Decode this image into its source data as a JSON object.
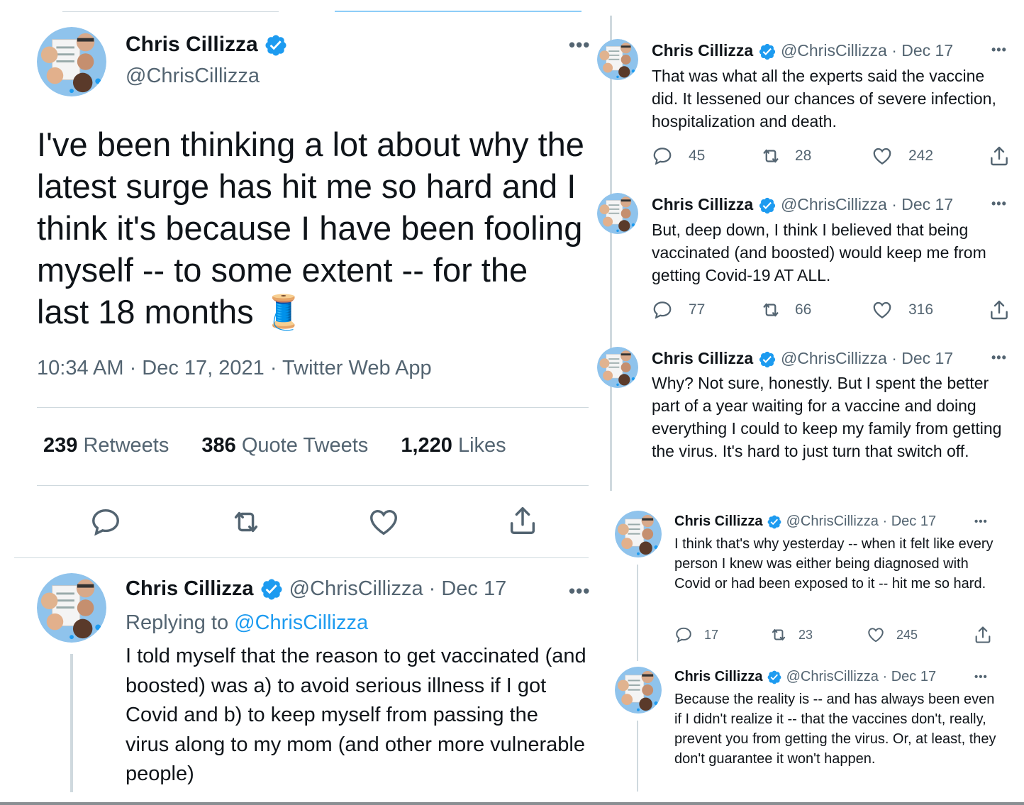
{
  "author": {
    "name": "Chris Cillizza",
    "handle": "@ChrisCillizza"
  },
  "main_tweet": {
    "text": "I've been thinking a lot about why the latest surge has hit me so hard and I think it's because I have been fooling myself -- to some extent -- for the last 18 months",
    "emoji": "🧵",
    "timestamp": "10:34 AM · Dec 17, 2021 · Twitter Web App",
    "stats": {
      "retweets_count": "239",
      "retweets_label": "Retweets",
      "quotes_count": "386",
      "quotes_label": "Quote Tweets",
      "likes_count": "1,220",
      "likes_label": "Likes"
    }
  },
  "reply_tweet": {
    "date": "· Dec 17",
    "replying_prefix": "Replying to",
    "replying_handle": "@ChrisCillizza",
    "text": "I told myself that the reason to get vaccinated (and boosted) was a) to avoid serious illness if I got Covid and b) to keep myself from passing the virus along to my mom (and other more vulnerable people)"
  },
  "thread": [
    {
      "date": "· Dec 17",
      "text": "That was what all the experts said the vaccine did. It lessened our chances of severe infection, hospitalization and death.",
      "replies": "45",
      "retweets": "28",
      "likes": "242"
    },
    {
      "date": "· Dec 17",
      "text": "But, deep down, I think I believed that being vaccinated (and boosted) would keep me from getting Covid-19 AT ALL.",
      "replies": "77",
      "retweets": "66",
      "likes": "316"
    },
    {
      "date": "· Dec 17",
      "text": "Why? Not sure, honestly. But I spent the better part of a year waiting for a vaccine and doing everything I could to keep my family from getting the virus.  It's hard to just turn that switch off."
    },
    {
      "date": "· Dec 17",
      "text": "I think that's why yesterday -- when it felt like every person I knew was either being diagnosed with Covid or had been exposed to it -- hit me so hard.",
      "replies": "17",
      "retweets": "23",
      "likes": "245"
    },
    {
      "date": "· Dec 17",
      "text": "Because the reality is -- and has always been even if I didn't realize it -- that the vaccines don't, really, prevent you from getting the virus. Or, at least, they don't guarantee it won't happen."
    }
  ],
  "colors": {
    "text": "#0f1419",
    "secondary": "#536471",
    "accent": "#1d9bf0",
    "divider": "#cfd9de"
  },
  "icons": [
    "avatar-collage",
    "verified-badge-icon",
    "more-icon",
    "reply-icon",
    "retweet-icon",
    "like-icon",
    "share-icon"
  ]
}
